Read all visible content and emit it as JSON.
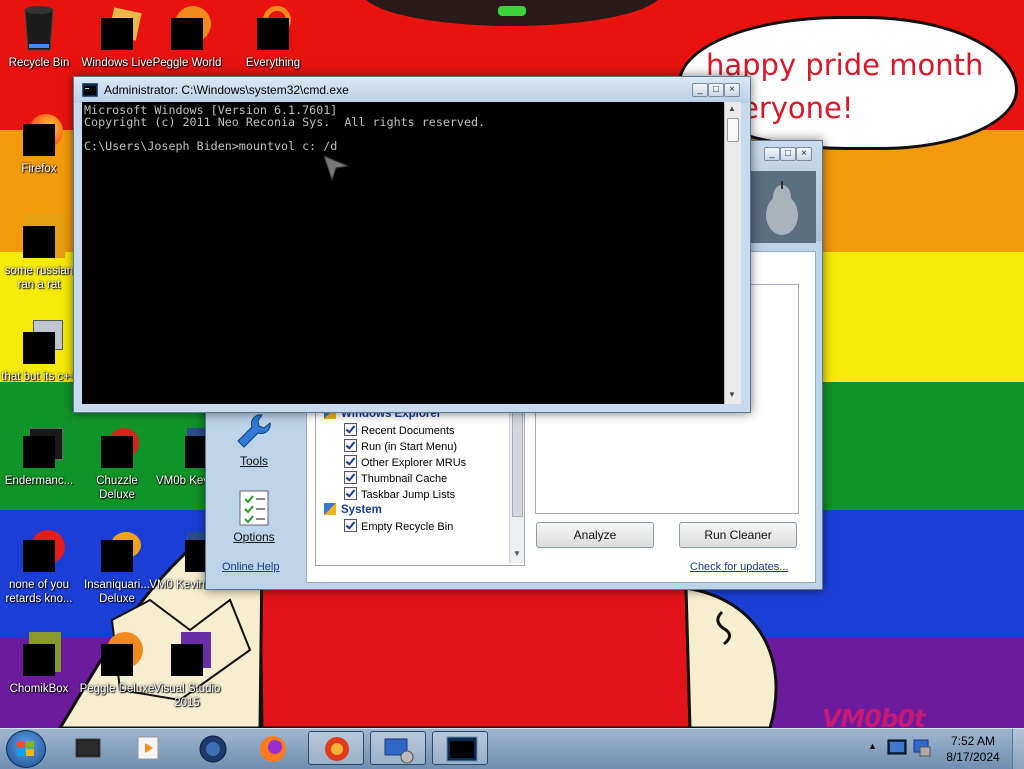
{
  "desktop": {
    "bubble_text": "happy pride month everyone!",
    "watermark": "VM0b0t",
    "icons": [
      {
        "label": "Recycle Bin"
      },
      {
        "label": "Windows Live"
      },
      {
        "label": "Peggle World"
      },
      {
        "label": "Everything"
      },
      {
        "label": "Firefox"
      },
      {
        "label": "some russian ran a rat"
      },
      {
        "label": "that but its c++"
      },
      {
        "label": "Endermanc..."
      },
      {
        "label": "Chuzzle Deluxe"
      },
      {
        "label": "VM0b Kevin"
      },
      {
        "label": "none of you retards kno..."
      },
      {
        "label": "Insaniquari... Deluxe"
      },
      {
        "label": "VM0 KevinSi..."
      },
      {
        "label": "ChomikBox"
      },
      {
        "label": "Peggle Deluxe"
      },
      {
        "label": "Visual Studio 2015"
      }
    ]
  },
  "cmd": {
    "title": "Administrator: C:\\Windows\\system32\\cmd.exe",
    "line1": "Microsoft Windows [Version 6.1.7601]",
    "line2": "Copyright (c) 2011 Neo Reconia Sys.  All rights reserved.",
    "line3": "",
    "line4": "C:\\Users\\Joseph Biden>mountvol c: /d"
  },
  "cleaner": {
    "sidebar": {
      "tools": "Tools",
      "options": "Options"
    },
    "sections": [
      {
        "name": "Windows Explorer",
        "items": [
          "Recent Documents",
          "Run (in Start Menu)",
          "Other Explorer MRUs",
          "Thumbnail Cache",
          "Taskbar Jump Lists"
        ]
      },
      {
        "name": "System",
        "items": [
          "Empty Recycle Bin"
        ]
      }
    ],
    "analyze": "Analyze",
    "run_cleaner": "Run Cleaner",
    "online_help": "Online Help",
    "check_updates": "Check for updates..."
  },
  "taskbar": {
    "time": "7:52 AM",
    "date": "8/17/2024"
  },
  "colors": {
    "bubble_text": "#d8182a",
    "rainbow": [
      "#e8130f",
      "#f39a0c",
      "#f6eb06",
      "#109428",
      "#1b3fd6",
      "#6c1b9c"
    ]
  }
}
